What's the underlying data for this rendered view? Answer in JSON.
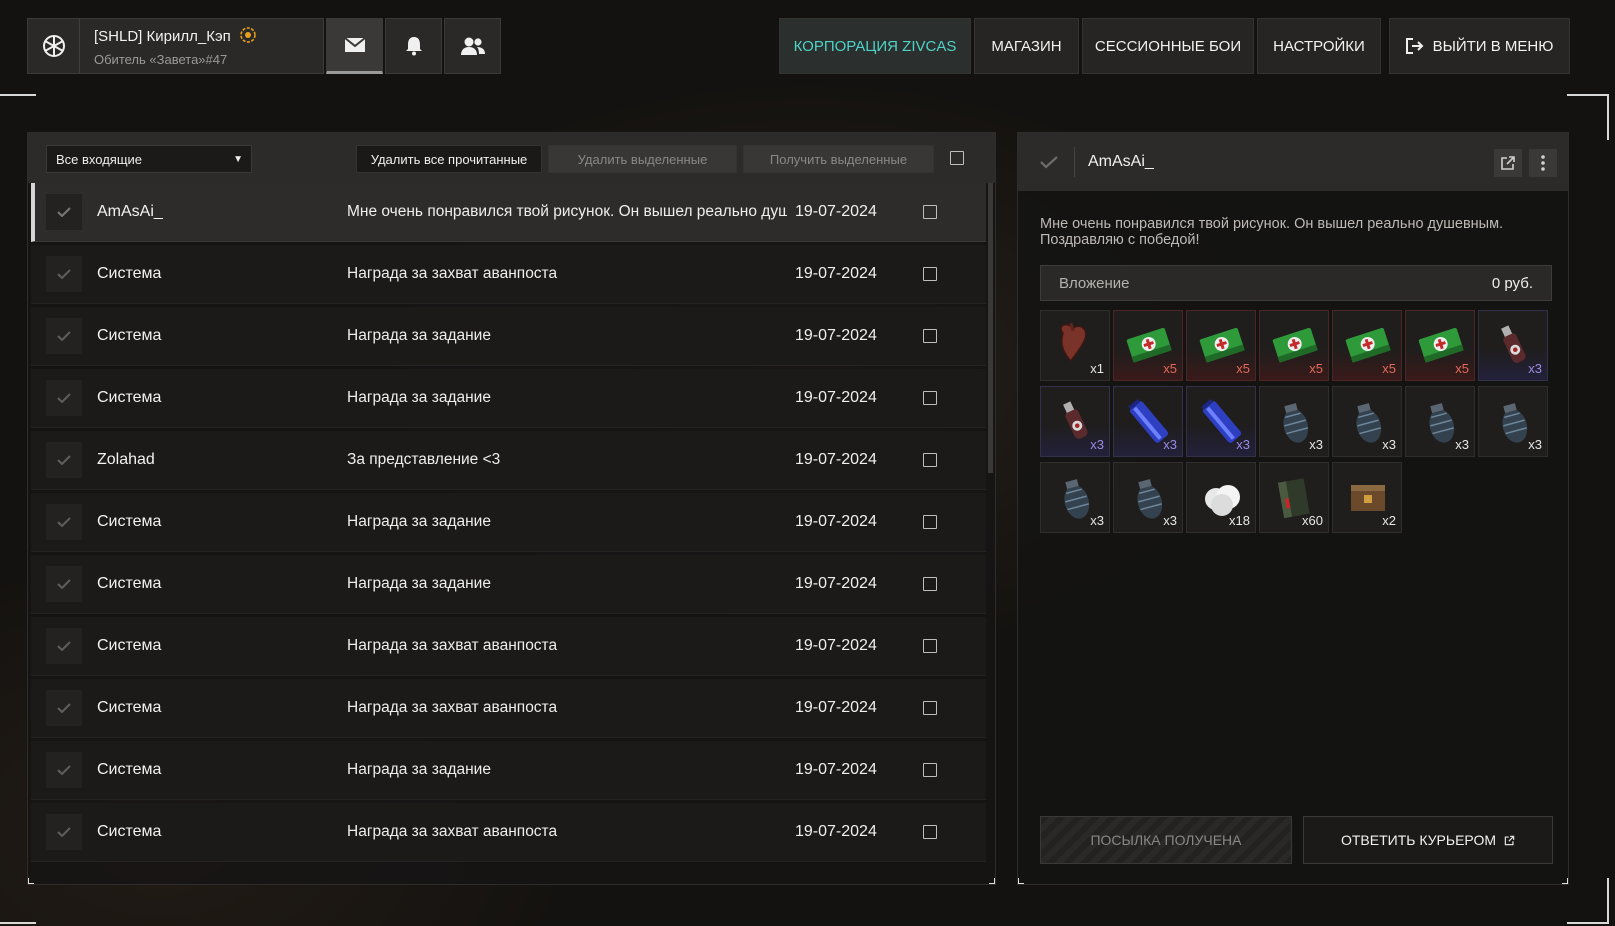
{
  "profile": {
    "name": "[SHLD] Кирилл_Кэп",
    "subtitle": "Обитель «Завета»#47"
  },
  "nav": {
    "items": [
      {
        "label": "КОРПОРАЦИЯ ZIVCAS",
        "active": true
      },
      {
        "label": "МАГАЗИН",
        "active": false
      },
      {
        "label": "СЕССИОННЫЕ БОИ",
        "active": false
      },
      {
        "label": "НАСТРОЙКИ",
        "active": false
      }
    ],
    "exit_label": "ВЫЙТИ В МЕНЮ"
  },
  "toolbar": {
    "filter_value": "Все входящие",
    "delete_read_label": "Удалить все прочитанные",
    "delete_selected_label": "Удалить выделенные",
    "receive_selected_label": "Получить выделенные"
  },
  "messages": [
    {
      "sender": "AmAsAi_",
      "subject": "Мне очень понравился твой рисунок. Он вышел реально душевным.",
      "date": "19-07-2024"
    },
    {
      "sender": "Система",
      "subject": "Награда за захват аванпоста",
      "date": "19-07-2024"
    },
    {
      "sender": "Система",
      "subject": "Награда за задание",
      "date": "19-07-2024"
    },
    {
      "sender": "Система",
      "subject": "Награда за задание",
      "date": "19-07-2024"
    },
    {
      "sender": "Zolahad",
      "subject": "За представление <3",
      "date": "19-07-2024"
    },
    {
      "sender": "Система",
      "subject": "Награда за задание",
      "date": "19-07-2024"
    },
    {
      "sender": "Система",
      "subject": "Награда за задание",
      "date": "19-07-2024"
    },
    {
      "sender": "Система",
      "subject": "Награда за захват аванпоста",
      "date": "19-07-2024"
    },
    {
      "sender": "Система",
      "subject": "Награда за захват аванпоста",
      "date": "19-07-2024"
    },
    {
      "sender": "Система",
      "subject": "Награда за задание",
      "date": "19-07-2024"
    },
    {
      "sender": "Система",
      "subject": "Награда за захват аванпоста",
      "date": "19-07-2024"
    }
  ],
  "detail": {
    "sender": "AmAsAi_",
    "message": "Мне очень понравился твой рисунок. Он вышел реально душевным. Поздравляю с победой!",
    "attachment_label": "Вложение",
    "attachment_money": "0 руб.",
    "items": [
      {
        "icon": "heart-organ-icon",
        "qty": "x1",
        "rarity": "normal"
      },
      {
        "icon": "medkit-icon",
        "qty": "x5",
        "rarity": "rare"
      },
      {
        "icon": "medkit-icon",
        "qty": "x5",
        "rarity": "rare"
      },
      {
        "icon": "medkit-icon",
        "qty": "x5",
        "rarity": "rare"
      },
      {
        "icon": "medkit-icon",
        "qty": "x5",
        "rarity": "rare"
      },
      {
        "icon": "medkit-icon",
        "qty": "x5",
        "rarity": "rare"
      },
      {
        "icon": "stim-bottle-icon",
        "qty": "x3",
        "rarity": "blue"
      },
      {
        "icon": "stim-bottle-icon",
        "qty": "x3",
        "rarity": "blue"
      },
      {
        "icon": "blue-battery-icon",
        "qty": "x3",
        "rarity": "blue"
      },
      {
        "icon": "blue-battery-icon",
        "qty": "x3",
        "rarity": "blue"
      },
      {
        "icon": "grenade-icon",
        "qty": "x3",
        "rarity": "normal"
      },
      {
        "icon": "grenade-icon",
        "qty": "x3",
        "rarity": "normal"
      },
      {
        "icon": "grenade-icon",
        "qty": "x3",
        "rarity": "normal"
      },
      {
        "icon": "grenade-icon",
        "qty": "x3",
        "rarity": "normal"
      },
      {
        "icon": "grenade-icon",
        "qty": "x3",
        "rarity": "normal"
      },
      {
        "icon": "grenade-icon",
        "qty": "x3",
        "rarity": "normal"
      },
      {
        "icon": "cotton-icon",
        "qty": "x18",
        "rarity": "normal"
      },
      {
        "icon": "ammo-pack-icon",
        "qty": "x60",
        "rarity": "normal"
      },
      {
        "icon": "ammo-crate-icon",
        "qty": "x2",
        "rarity": "normal"
      }
    ],
    "parcel_received_label": "ПОСЫЛКА ПОЛУЧЕНА",
    "reply_courier_label": "ОТВЕТИТЬ КУРЬЕРОМ"
  },
  "colors": {
    "accent": "#4fd3c8",
    "rare": "#e56a5a",
    "uncommon": "#9a8be6"
  }
}
